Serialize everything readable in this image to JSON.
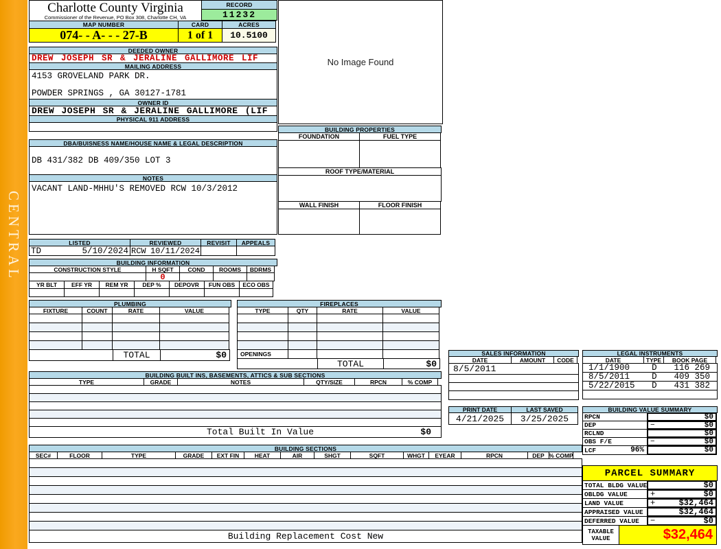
{
  "sidebar": {
    "label": "CENTRAL"
  },
  "county": {
    "title": "Charlotte County Virginia",
    "subtitle": "Commissioner of the Revenue, PO Box 308, Charlotte CH, VA"
  },
  "record": {
    "label": "RECORD",
    "value": "11232"
  },
  "map": {
    "label": "MAP NUMBER",
    "value": "074-  - A-  -   - 27-B"
  },
  "card": {
    "label": "CARD",
    "value": "1 of 1"
  },
  "acres": {
    "label": "ACRES",
    "value": "10.5100"
  },
  "deeded_owner": {
    "label": "DEEDED OWNER",
    "value": "DREW JOSEPH SR & JERALINE GALLIMORE  LIF"
  },
  "mailing": {
    "label": "MAILING ADDRESS",
    "line1": "4153 GROVELAND PARK DR.",
    "line2": "POWDER SPRINGS , GA 30127-1781"
  },
  "owner_id": {
    "label": "OWNER ID",
    "value": "DREW JOSEPH SR & JERALINE GALLIMORE (LIF"
  },
  "physical": {
    "label": "PHYSICAL 911 ADDRESS",
    "value": ""
  },
  "dba": {
    "label": "DBA/BUISNESS NAME/HOUSE NAME & LEGAL DESCRIPTION",
    "value": "DB 431/382 DB 409/350 LOT 3"
  },
  "notes": {
    "label": "NOTES",
    "value": "VACANT LAND-MHHU'S REMOVED RCW 10/3/2012"
  },
  "review": {
    "cols": [
      "LISTED",
      "REVIEWED",
      "REVISIT",
      "APPEALS"
    ],
    "listed_by": "TD",
    "listed_date": "5/10/2024",
    "reviewed_by": "RCW",
    "reviewed_date": "10/11/2024",
    "revisit": "",
    "appeals": ""
  },
  "building_info": {
    "label": "BUILDING INFORMATION",
    "cols1": [
      "CONSTRUCTION STYLE",
      "H SQFT",
      "COND",
      "ROOMS",
      "BDRMS"
    ],
    "h_sqft": "0",
    "cols2": [
      "YR BLT",
      "EFF YR",
      "REM YR",
      "DEP %",
      "DEPOVR",
      "FUN OBS",
      "ECO OBS"
    ]
  },
  "plumbing": {
    "label": "PLUMBING",
    "cols": [
      "FIXTURE",
      "COUNT",
      "RATE",
      "VALUE"
    ],
    "total_label": "TOTAL",
    "total_value": "$0"
  },
  "fireplaces": {
    "label": "FIREPLACES",
    "cols": [
      "TYPE",
      "QTY",
      "RATE",
      "VALUE"
    ],
    "openings_label": "OPENINGS",
    "total_label": "TOTAL",
    "total_value": "$0"
  },
  "built_ins": {
    "label": "BUILDING BUILT INS, BASEMENTS, ATTICS & SUB SECTIONS",
    "cols": [
      "TYPE",
      "GRADE",
      "NOTES",
      "QTY/SIZE",
      "RPCN",
      "% COMP"
    ],
    "total_label": "Total Built In Value",
    "total_value": "$0"
  },
  "sections": {
    "label": "BUILDING SECTIONS",
    "cols": [
      "SEC#",
      "FLOOR",
      "TYPE",
      "GRADE",
      "EXT FIN",
      "HEAT",
      "AIR",
      "SHGT",
      "SQFT",
      "WHGT",
      "EYEAR",
      "RPCN",
      "DEP",
      "% COMP"
    ]
  },
  "replacement": {
    "label": "Building Replacement Cost New"
  },
  "image_box": {
    "text": "No Image Found"
  },
  "building_properties": {
    "label": "BUILDING PROPERTIES",
    "foundation_label": "FOUNDATION",
    "fuel_label": "FUEL TYPE",
    "roof_label": "ROOF TYPE/MATERIAL",
    "wall_label": "WALL FINISH",
    "floor_label": "FLOOR FINISH"
  },
  "sales": {
    "label": "SALES INFORMATION",
    "cols": [
      "DATE",
      "AMOUNT",
      "CODE"
    ],
    "rows": [
      {
        "date": "8/5/2011",
        "amount": "",
        "code": ""
      }
    ]
  },
  "legal": {
    "label": "LEGAL INSTRUMENTS",
    "cols": [
      "DATE",
      "TYPE",
      "BOOK PAGE"
    ],
    "rows": [
      {
        "date": "1/1/1900",
        "type": "D",
        "book_page": "116 269"
      },
      {
        "date": "8/5/2011",
        "type": "D",
        "book_page": "409 350"
      },
      {
        "date": "5/22/2015",
        "type": "D",
        "book_page": "431 382"
      }
    ]
  },
  "dates": {
    "print_label": "PRINT DATE",
    "print_value": "4/21/2025",
    "saved_label": "LAST SAVED",
    "saved_value": "3/25/2025"
  },
  "value_summary": {
    "label": "BUILDING VALUE SUMMARY",
    "rows": [
      {
        "name": "RPCN",
        "pct": "",
        "op": "",
        "value": "$0"
      },
      {
        "name": "DEP",
        "pct": "",
        "op": "−",
        "value": "$0"
      },
      {
        "name": "RCLND",
        "pct": "",
        "op": "",
        "value": "$0"
      },
      {
        "name": "OBS F/E",
        "pct": "",
        "op": "−",
        "value": "$0"
      },
      {
        "name": "LCF",
        "pct": "96%",
        "op": "",
        "value": "$0"
      }
    ]
  },
  "parcel_summary": {
    "label": "PARCEL SUMMARY",
    "rows": [
      {
        "name": "TOTAL BLDG VALUE",
        "op": "",
        "value": "$0"
      },
      {
        "name": "OBLDG VALUE",
        "op": "+",
        "value": "$0"
      },
      {
        "name": "LAND VALUE",
        "op": "+",
        "value": "$32,464"
      },
      {
        "name": "APPRAISED VALUE",
        "op": "",
        "value": "$32,464"
      },
      {
        "name": "DEFERRED VALUE",
        "op": "−",
        "value": "$0"
      }
    ],
    "taxable_label": "TAXABLE VALUE",
    "taxable_value": "$32,464"
  },
  "colors": {
    "accent_orange": "#FAA81E",
    "header_blue": "#B5D9E8",
    "highlight_yellow": "#FFFF00",
    "record_green": "#9CEB9C",
    "alert_red": "#CC0000"
  }
}
